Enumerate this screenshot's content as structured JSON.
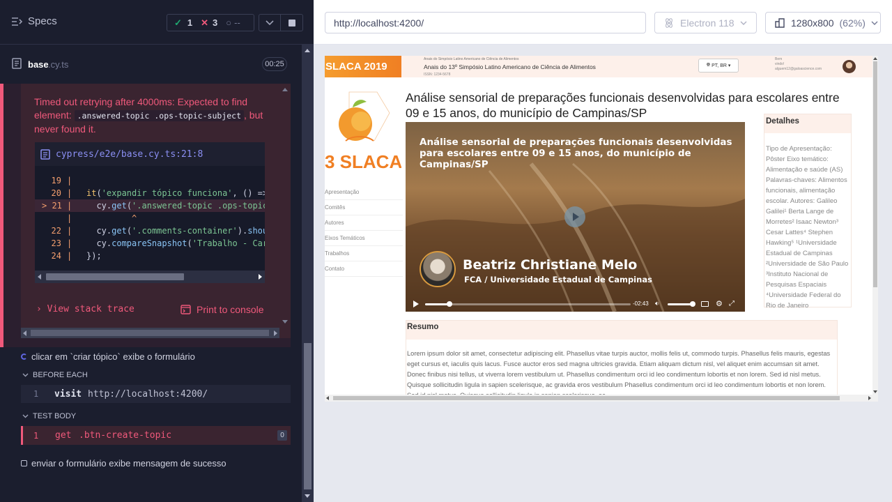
{
  "reporter": {
    "specs_label": "Specs",
    "stats": {
      "passed": "1",
      "failed": "3",
      "pending": "--"
    },
    "spec_file": {
      "name": "base",
      "ext": ".cy.ts",
      "duration": "00:25"
    },
    "error": {
      "message_prefix": "Timed out retrying after 4000ms: Expected to find element: ",
      "selector": ".answered-topic .ops-topic-subject",
      "message_suffix": ", but never found it.",
      "file_link": "cypress/e2e/base.cy.ts:21:8",
      "code_lines": [
        {
          "n": "19",
          "code": ""
        },
        {
          "n": "20",
          "code": "it('expandir tópico funciona', () =>"
        },
        {
          "n": "> 21",
          "code": "  cy.get('.answered-topic .ops-topic"
        },
        {
          "n": "",
          "code": "         ^"
        },
        {
          "n": "22",
          "code": "  cy.get('.comments-container').shoul"
        },
        {
          "n": "23",
          "code": "  cy.compareSnapshot('Trabalho - Car"
        },
        {
          "n": "24",
          "code": "});"
        }
      ],
      "view_stack_trace": "View stack trace",
      "print_to_console": "Print to console"
    },
    "test_running": "clicar em `criar tópico` exibe o formulário",
    "before_each": {
      "label": "BEFORE EACH",
      "row": {
        "n": "1",
        "command": "visit",
        "arg": "http://localhost:4200/"
      }
    },
    "test_body": {
      "label": "TEST BODY",
      "row": {
        "n": "1",
        "command": "get",
        "arg": ".btn-create-topic",
        "count": "0"
      }
    },
    "test_pending": "enviar o formulário exibe mensagem de sucesso"
  },
  "browser": {
    "url": "http://localhost:4200/",
    "browser_name": "Electron 118",
    "viewport": "1280x800",
    "zoom": "(62%)"
  },
  "app": {
    "header": {
      "badge": "SLACA 2019",
      "small": "Anais do Simpósio Latino Americano de Ciência de Alimentos",
      "title": "Anais do 13º Simpósio Latino Americano de Ciência de Alimentos",
      "issn": "ISSN: 1234-5678",
      "lang": "PT, BR",
      "user_bem": "Bem",
      "user_vindo": "vindo!",
      "user_email": "alguem12@galoascience.com"
    },
    "logo_text": "3 SLACA",
    "nav": [
      "Apresentação",
      "Comitês",
      "Autores",
      "Eixos Temáticos",
      "Trabalhos",
      "Contato"
    ],
    "article_title": "Análise sensorial de preparações funcionais desenvolvidas para escolares entre 09 e 15 anos, do município de Campinas/SP",
    "video": {
      "title": "Análise sensorial de preparações funcionais desenvolvidas para escolares entre 09 e 15 anos, do município de Campinas/SP",
      "speaker": "Beatriz Christiane Melo",
      "affiliation": "FCA / Universidade Estadual de Campinas",
      "time_remaining": "-02:43",
      "progress": 0.12
    },
    "details": {
      "heading": "Detalhes",
      "body": "Tipo de Apresentação: Pôster Eixo temático: Alimentação e saúde (AS) Palavras-chaves: Alimentos funcionais, alimentação escolar. Autores: Galileo Galilei¹ Berta Lange de Morretes² Isaac Newton³ Cesar Lattes⁴ Stephen Hawking⁵ ¹Universidade Estadual de Campinas ²Universidade de São Paulo ³Instituto Nacional de Pesquisas Espaciais ⁴Universidade Federal do Rio de Janeiro"
    },
    "resumo": {
      "heading": "Resumo",
      "body": "Lorem ipsum dolor sit amet, consectetur adipiscing elit. Phasellus vitae turpis auctor, mollis felis ut, commodo turpis. Phasellus felis mauris, egestas eget cursus et, iaculis quis lacus. Fusce auctor eros sed magna ultricies gravida. Etiam aliquam dictum nisl, vel aliquet enim accumsan sit amet. Donec finibus nisi tellus, ut viverra lorem vestibulum ut. Phasellus condimentum orci id leo condimentum lobortis et non lorem. Sed id nisl metus. Quisque sollicitudin ligula in sapien scelerisque, ac gravida eros vestibulum Phasellus condimentum orci id leo condimentum lobortis et non lorem. Sed id nisl metus. Quisque sollicitudin ligula in sapien scelerisque, ac"
    }
  }
}
